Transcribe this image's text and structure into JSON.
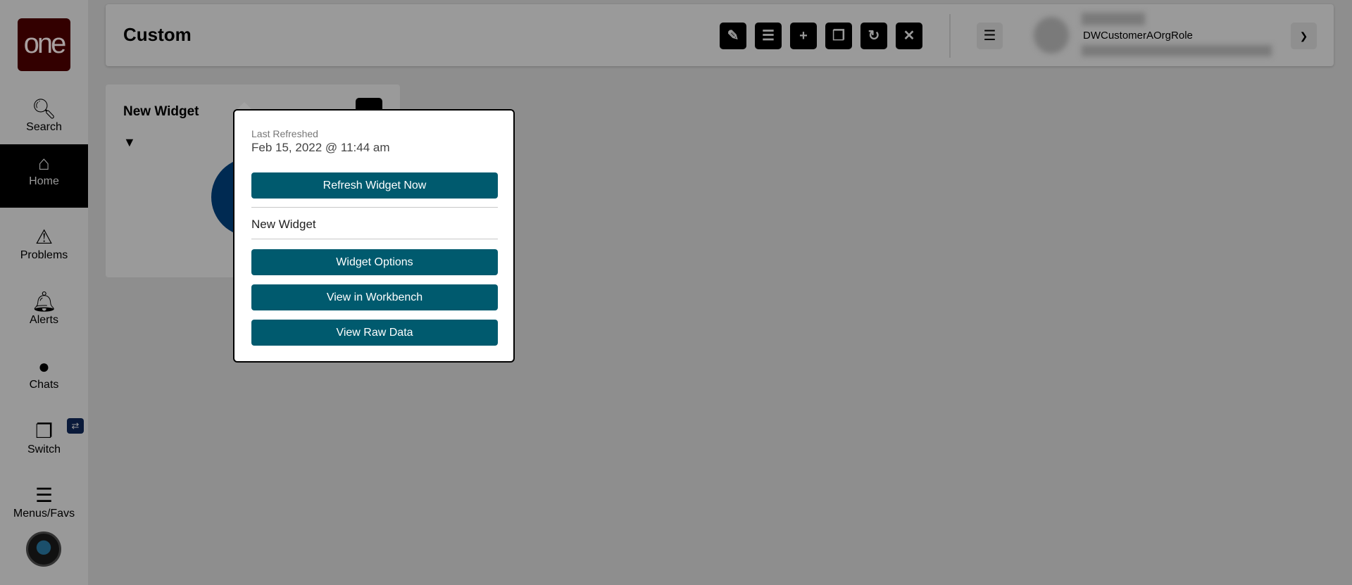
{
  "logo": "one",
  "sidebar": {
    "items": [
      {
        "label": "Search",
        "icon": "search-icon"
      },
      {
        "label": "Home",
        "icon": "home-icon",
        "active": true
      },
      {
        "label": "Problems",
        "icon": "warning-icon"
      },
      {
        "label": "Alerts",
        "icon": "bell-icon"
      },
      {
        "label": "Chats",
        "icon": "chat-icon"
      },
      {
        "label": "Switch",
        "icon": "switch-icon"
      },
      {
        "label": "Menus/Favs",
        "icon": "menu-icon"
      }
    ]
  },
  "header": {
    "title": "Custom",
    "role": "DWCustomerAOrgRole",
    "toolbar": [
      "pencil-icon",
      "list-icon",
      "plus-icon",
      "copy-icon",
      "refresh-icon",
      "close-icon"
    ]
  },
  "widget": {
    "title": "New Widget",
    "chart_color": "#003057"
  },
  "popup": {
    "last_refreshed_label": "Last Refreshed",
    "last_refreshed_value": "Feb 15, 2022 @ 11:44 am",
    "refresh_button": "Refresh Widget Now",
    "widget_name": "New Widget",
    "options_button": "Widget Options",
    "workbench_button": "View in Workbench",
    "raw_data_button": "View Raw Data",
    "accent": "#005a6e"
  }
}
